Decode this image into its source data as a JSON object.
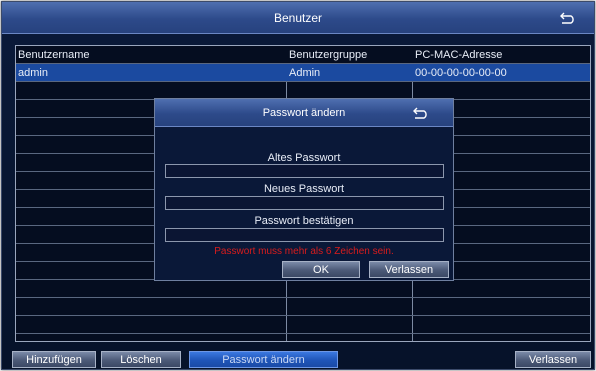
{
  "window": {
    "title": "Benutzer",
    "back_icon": "back-arrow-icon"
  },
  "table": {
    "columns": [
      "Benutzername",
      "Benutzergruppe",
      "PC-MAC-Adresse"
    ],
    "rows": [
      {
        "username": "admin",
        "group": "Admin",
        "mac": "00-00-00-00-00-00"
      }
    ]
  },
  "dialog": {
    "title": "Passwort ändern",
    "back_icon": "back-arrow-icon",
    "old_password_label": "Altes Passwort",
    "new_password_label": "Neues Passwort",
    "confirm_password_label": "Passwort bestätigen",
    "error": "Passwort muss mehr als 6 Zeichen sein.",
    "ok_label": "OK",
    "exit_label": "Verlassen"
  },
  "footer": {
    "add_label": "Hinzufügen",
    "delete_label": "Löschen",
    "change_password_label": "Passwort ändern",
    "exit_label": "Verlassen"
  },
  "colors": {
    "accent": "#1f55b8",
    "error": "#d91c1c",
    "background": "#061229"
  }
}
